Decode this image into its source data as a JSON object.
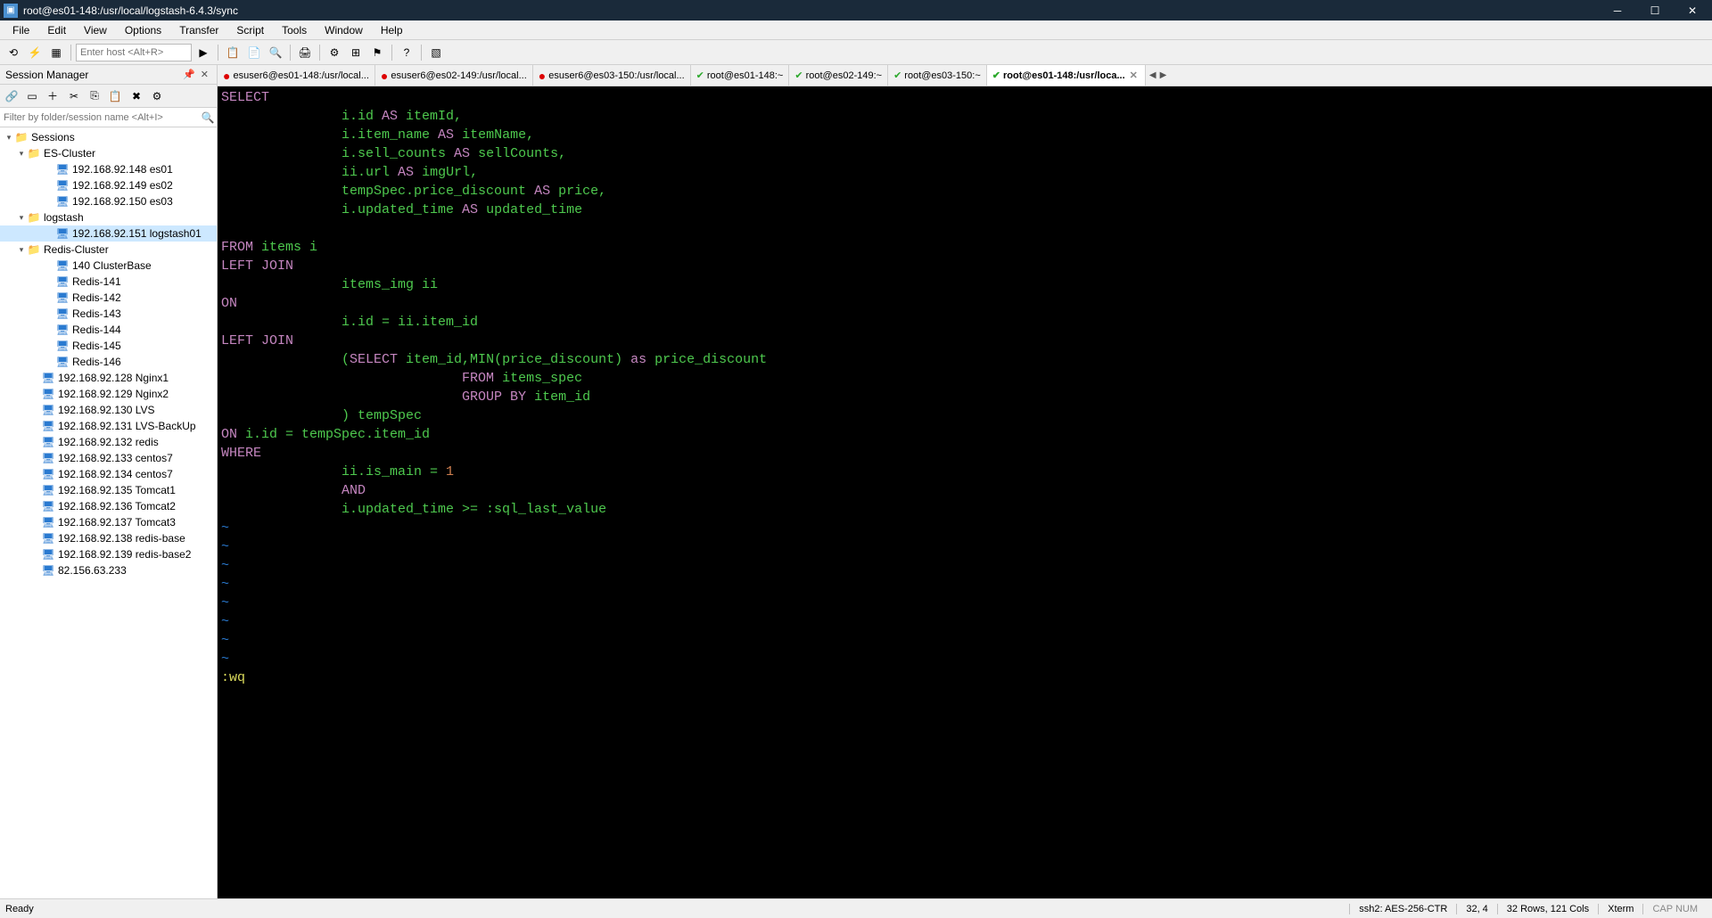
{
  "title_bar": {
    "title": "root@es01-148:/usr/local/logstash-6.4.3/sync"
  },
  "menu": [
    "File",
    "Edit",
    "View",
    "Options",
    "Transfer",
    "Script",
    "Tools",
    "Window",
    "Help"
  ],
  "toolbar": {
    "host_placeholder": "Enter host <Alt+R>"
  },
  "sidebar": {
    "title": "Session Manager",
    "filter_placeholder": "Filter by folder/session name <Alt+I>",
    "root": "Sessions",
    "tree": [
      {
        "type": "folder",
        "label": "ES-Cluster",
        "indent": 1,
        "expanded": true
      },
      {
        "type": "session",
        "label": "192.168.92.148 es01",
        "indent": 3
      },
      {
        "type": "session",
        "label": "192.168.92.149 es02",
        "indent": 3
      },
      {
        "type": "session",
        "label": "192.168.92.150 es03",
        "indent": 3
      },
      {
        "type": "folder",
        "label": "logstash",
        "indent": 1,
        "expanded": true
      },
      {
        "type": "session",
        "label": "192.168.92.151 logstash01",
        "indent": 3,
        "selected": true
      },
      {
        "type": "folder",
        "label": "Redis-Cluster",
        "indent": 1,
        "expanded": true
      },
      {
        "type": "session",
        "label": "140 ClusterBase",
        "indent": 3
      },
      {
        "type": "session",
        "label": "Redis-141",
        "indent": 3
      },
      {
        "type": "session",
        "label": "Redis-142",
        "indent": 3
      },
      {
        "type": "session",
        "label": "Redis-143",
        "indent": 3
      },
      {
        "type": "session",
        "label": "Redis-144",
        "indent": 3
      },
      {
        "type": "session",
        "label": "Redis-145",
        "indent": 3
      },
      {
        "type": "session",
        "label": "Redis-146",
        "indent": 3
      },
      {
        "type": "session",
        "label": "192.168.92.128  Nginx1",
        "indent": 2
      },
      {
        "type": "session",
        "label": "192.168.92.129  Nginx2",
        "indent": 2
      },
      {
        "type": "session",
        "label": "192.168.92.130  LVS",
        "indent": 2
      },
      {
        "type": "session",
        "label": "192.168.92.131  LVS-BackUp",
        "indent": 2
      },
      {
        "type": "session",
        "label": "192.168.92.132  redis",
        "indent": 2
      },
      {
        "type": "session",
        "label": "192.168.92.133  centos7",
        "indent": 2
      },
      {
        "type": "session",
        "label": "192.168.92.134  centos7",
        "indent": 2
      },
      {
        "type": "session",
        "label": "192.168.92.135  Tomcat1",
        "indent": 2
      },
      {
        "type": "session",
        "label": "192.168.92.136  Tomcat2",
        "indent": 2
      },
      {
        "type": "session",
        "label": "192.168.92.137  Tomcat3",
        "indent": 2
      },
      {
        "type": "session",
        "label": "192.168.92.138 redis-base",
        "indent": 2
      },
      {
        "type": "session",
        "label": "192.168.92.139 redis-base2",
        "indent": 2
      },
      {
        "type": "session",
        "label": "82.156.63.233",
        "indent": 2
      }
    ]
  },
  "tabs": [
    {
      "label": "esuser6@es01-148:/usr/local...",
      "status": "dot",
      "active": false
    },
    {
      "label": "esuser6@es02-149:/usr/local...",
      "status": "dot",
      "active": false
    },
    {
      "label": "esuser6@es03-150:/usr/local...",
      "status": "dot",
      "active": false
    },
    {
      "label": "root@es01-148:~",
      "status": "check",
      "active": false
    },
    {
      "label": "root@es02-149:~",
      "status": "check",
      "active": false
    },
    {
      "label": "root@es03-150:~",
      "status": "check",
      "active": false
    },
    {
      "label": "root@es01-148:/usr/loca...",
      "status": "check",
      "active": true,
      "closable": true
    }
  ],
  "terminal": {
    "lines": [
      [
        {
          "t": "SELECT",
          "c": "kw"
        }
      ],
      [
        {
          "t": "               i.id ",
          "c": "ident"
        },
        {
          "t": "AS",
          "c": "kw"
        },
        {
          "t": " itemId,",
          "c": "ident"
        }
      ],
      [
        {
          "t": "               i.item_name ",
          "c": "ident"
        },
        {
          "t": "AS",
          "c": "kw"
        },
        {
          "t": " itemName,",
          "c": "ident"
        }
      ],
      [
        {
          "t": "               i.sell_counts ",
          "c": "ident"
        },
        {
          "t": "AS",
          "c": "kw"
        },
        {
          "t": " sellCounts,",
          "c": "ident"
        }
      ],
      [
        {
          "t": "               ii.url ",
          "c": "ident"
        },
        {
          "t": "AS",
          "c": "kw"
        },
        {
          "t": " imgUrl,",
          "c": "ident"
        }
      ],
      [
        {
          "t": "               tempSpec.price_discount ",
          "c": "ident"
        },
        {
          "t": "AS",
          "c": "kw"
        },
        {
          "t": " price,",
          "c": "ident"
        }
      ],
      [
        {
          "t": "               i.updated_time ",
          "c": "ident"
        },
        {
          "t": "AS",
          "c": "kw"
        },
        {
          "t": " updated_time",
          "c": "ident"
        }
      ],
      [
        {
          "t": "",
          "c": ""
        }
      ],
      [
        {
          "t": "FROM",
          "c": "kw"
        },
        {
          "t": " items i",
          "c": "ident"
        }
      ],
      [
        {
          "t": "LEFT JOIN",
          "c": "kw"
        }
      ],
      [
        {
          "t": "               items_img ii",
          "c": "ident"
        }
      ],
      [
        {
          "t": "ON",
          "c": "kw"
        }
      ],
      [
        {
          "t": "               i.id = ii.item_id",
          "c": "ident"
        }
      ],
      [
        {
          "t": "LEFT JOIN",
          "c": "kw"
        }
      ],
      [
        {
          "t": "               (",
          "c": "ident"
        },
        {
          "t": "SELECT",
          "c": "kw"
        },
        {
          "t": " item_id,MIN(price_discount) ",
          "c": "ident"
        },
        {
          "t": "as",
          "c": "kw"
        },
        {
          "t": " price_discount",
          "c": "ident"
        }
      ],
      [
        {
          "t": "                              ",
          "c": ""
        },
        {
          "t": "FROM",
          "c": "kw"
        },
        {
          "t": " items_spec",
          "c": "ident"
        }
      ],
      [
        {
          "t": "                              ",
          "c": ""
        },
        {
          "t": "GROUP BY",
          "c": "kw"
        },
        {
          "t": " item_id",
          "c": "ident"
        }
      ],
      [
        {
          "t": "               ) tempSpec",
          "c": "ident"
        }
      ],
      [
        {
          "t": "ON",
          "c": "kw"
        },
        {
          "t": " i.id = tempSpec.item_id",
          "c": "ident"
        }
      ],
      [
        {
          "t": "WHERE",
          "c": "kw"
        }
      ],
      [
        {
          "t": "               ii.is_main = ",
          "c": "ident"
        },
        {
          "t": "1",
          "c": "num"
        }
      ],
      [
        {
          "t": "               ",
          "c": ""
        },
        {
          "t": "AND",
          "c": "kw"
        }
      ],
      [
        {
          "t": "               i.updated_time >= :sql_last_value",
          "c": "ident"
        }
      ],
      [
        {
          "t": "~",
          "c": "blank"
        }
      ],
      [
        {
          "t": "~",
          "c": "blank"
        }
      ],
      [
        {
          "t": "~",
          "c": "blank"
        }
      ],
      [
        {
          "t": "~",
          "c": "blank"
        }
      ],
      [
        {
          "t": "~",
          "c": "blank"
        }
      ],
      [
        {
          "t": "~",
          "c": "blank"
        }
      ],
      [
        {
          "t": "~",
          "c": "blank"
        }
      ],
      [
        {
          "t": "~",
          "c": "blank"
        }
      ],
      [
        {
          "t": ":wq",
          "c": "cmd"
        }
      ]
    ]
  },
  "status_bar": {
    "ready": "Ready",
    "ssh": "ssh2: AES-256-CTR",
    "pos": "32,   4",
    "size": "32 Rows, 121 Cols",
    "term": "Xterm",
    "caps": "CAP NUM"
  }
}
